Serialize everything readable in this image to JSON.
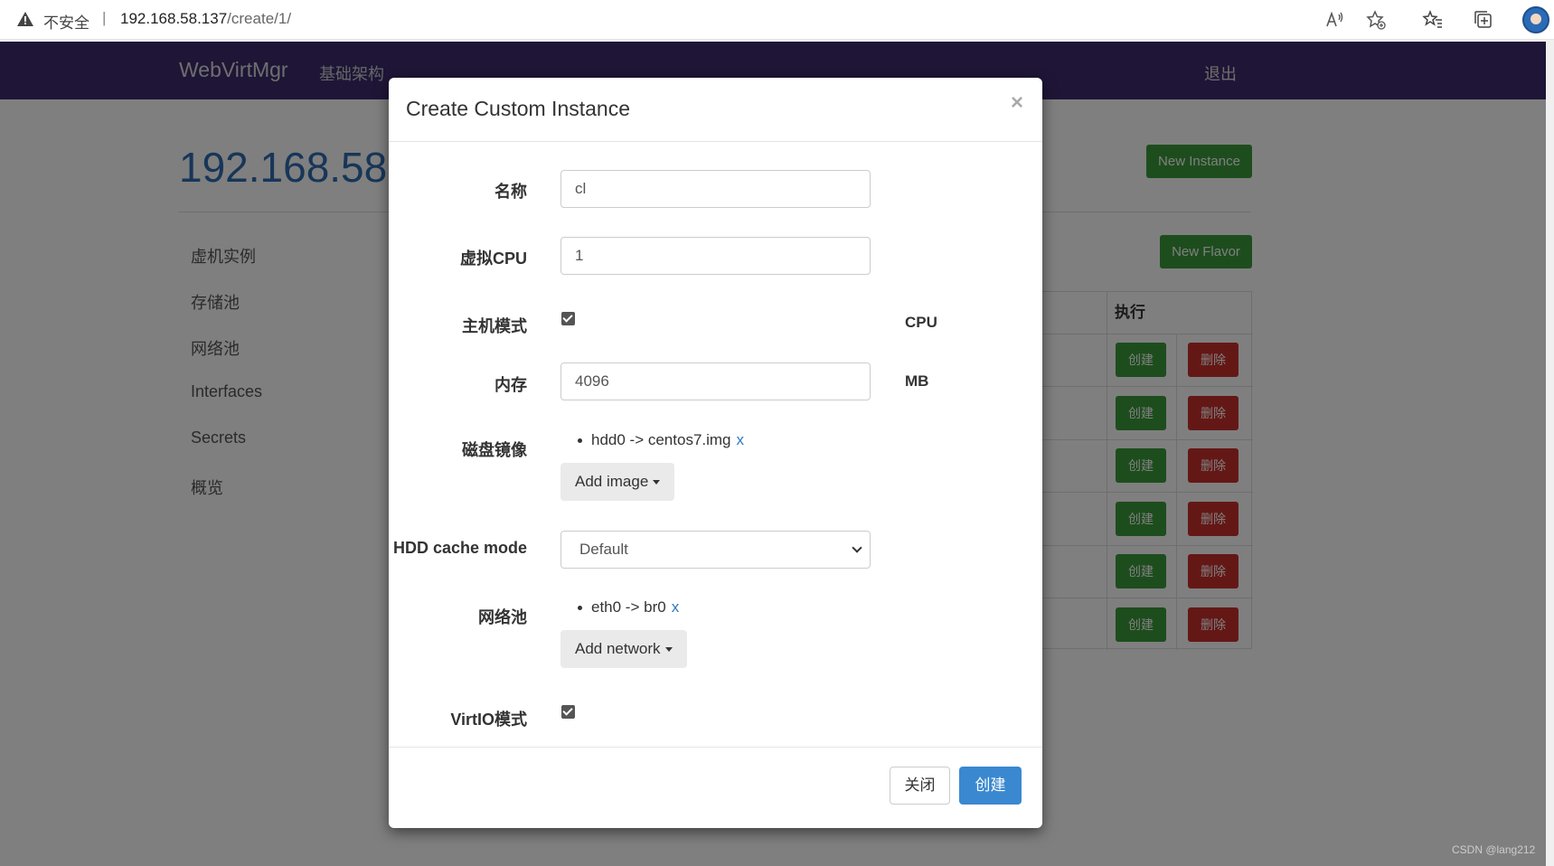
{
  "browser": {
    "insecure_label": "不安全",
    "separator": "|",
    "url_host": "192.168.58.137",
    "url_path": "/create/1/"
  },
  "navbar": {
    "brand": "WebVirtMgr",
    "infra_link": "基础架构",
    "logout": "退出"
  },
  "page": {
    "host_title": "192.168.58.",
    "new_instance_button": "New Instance",
    "new_flavor_button": "New Flavor",
    "sidebar": [
      {
        "label": "虚机实例"
      },
      {
        "label": "存储池"
      },
      {
        "label": "网络池"
      },
      {
        "label": "Interfaces"
      },
      {
        "label": "Secrets"
      },
      {
        "label": "概览"
      }
    ],
    "table": {
      "action_header": "执行",
      "create_label": "创建",
      "delete_label": "删除"
    }
  },
  "modal": {
    "title": "Create Custom Instance",
    "close_symbol": "×",
    "name": {
      "label": "名称",
      "value": "cl"
    },
    "vcpu": {
      "label": "虚拟CPU",
      "value": "1"
    },
    "host_mode": {
      "label": "主机模式",
      "suffix": "CPU",
      "checked": true
    },
    "memory": {
      "label": "内存",
      "value": "4096",
      "suffix": "MB"
    },
    "disk_image": {
      "label": "磁盘镜像",
      "item": "hdd0 -> centos7.img",
      "remove": "x",
      "add_button": "Add image"
    },
    "hdd_cache": {
      "label": "HDD cache mode",
      "selected": "Default"
    },
    "network": {
      "label": "网络池",
      "item": "eth0 -> br0",
      "remove": "x",
      "add_button": "Add network"
    },
    "virtio": {
      "label": "VirtIO模式",
      "checked": true
    },
    "footer": {
      "close_button": "关闭",
      "create_button": "创建"
    }
  },
  "watermark": "CSDN @lang212"
}
